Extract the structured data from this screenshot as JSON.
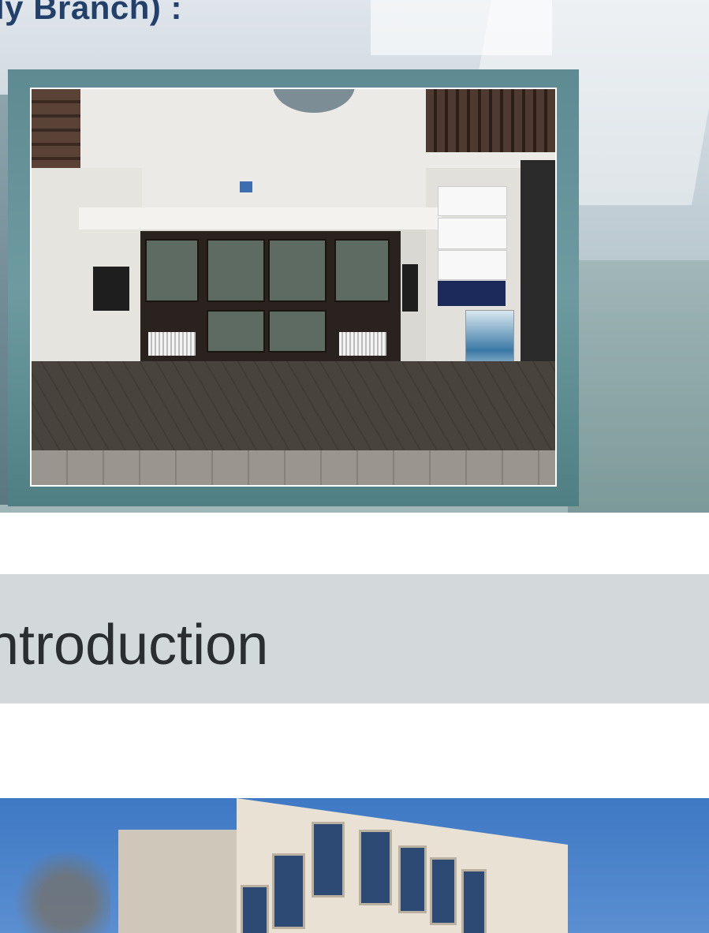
{
  "hero": {
    "title": "ly Branch) :",
    "photo_alt": "Entrance of clinic building with glass doors and signs"
  },
  "section": {
    "title": "ntroduction"
  },
  "colors": {
    "title_blue": "#23406b",
    "frame_teal": "#5e8b92",
    "band_gray": "#d3d8da",
    "sky_blue": "#3f79c4"
  }
}
